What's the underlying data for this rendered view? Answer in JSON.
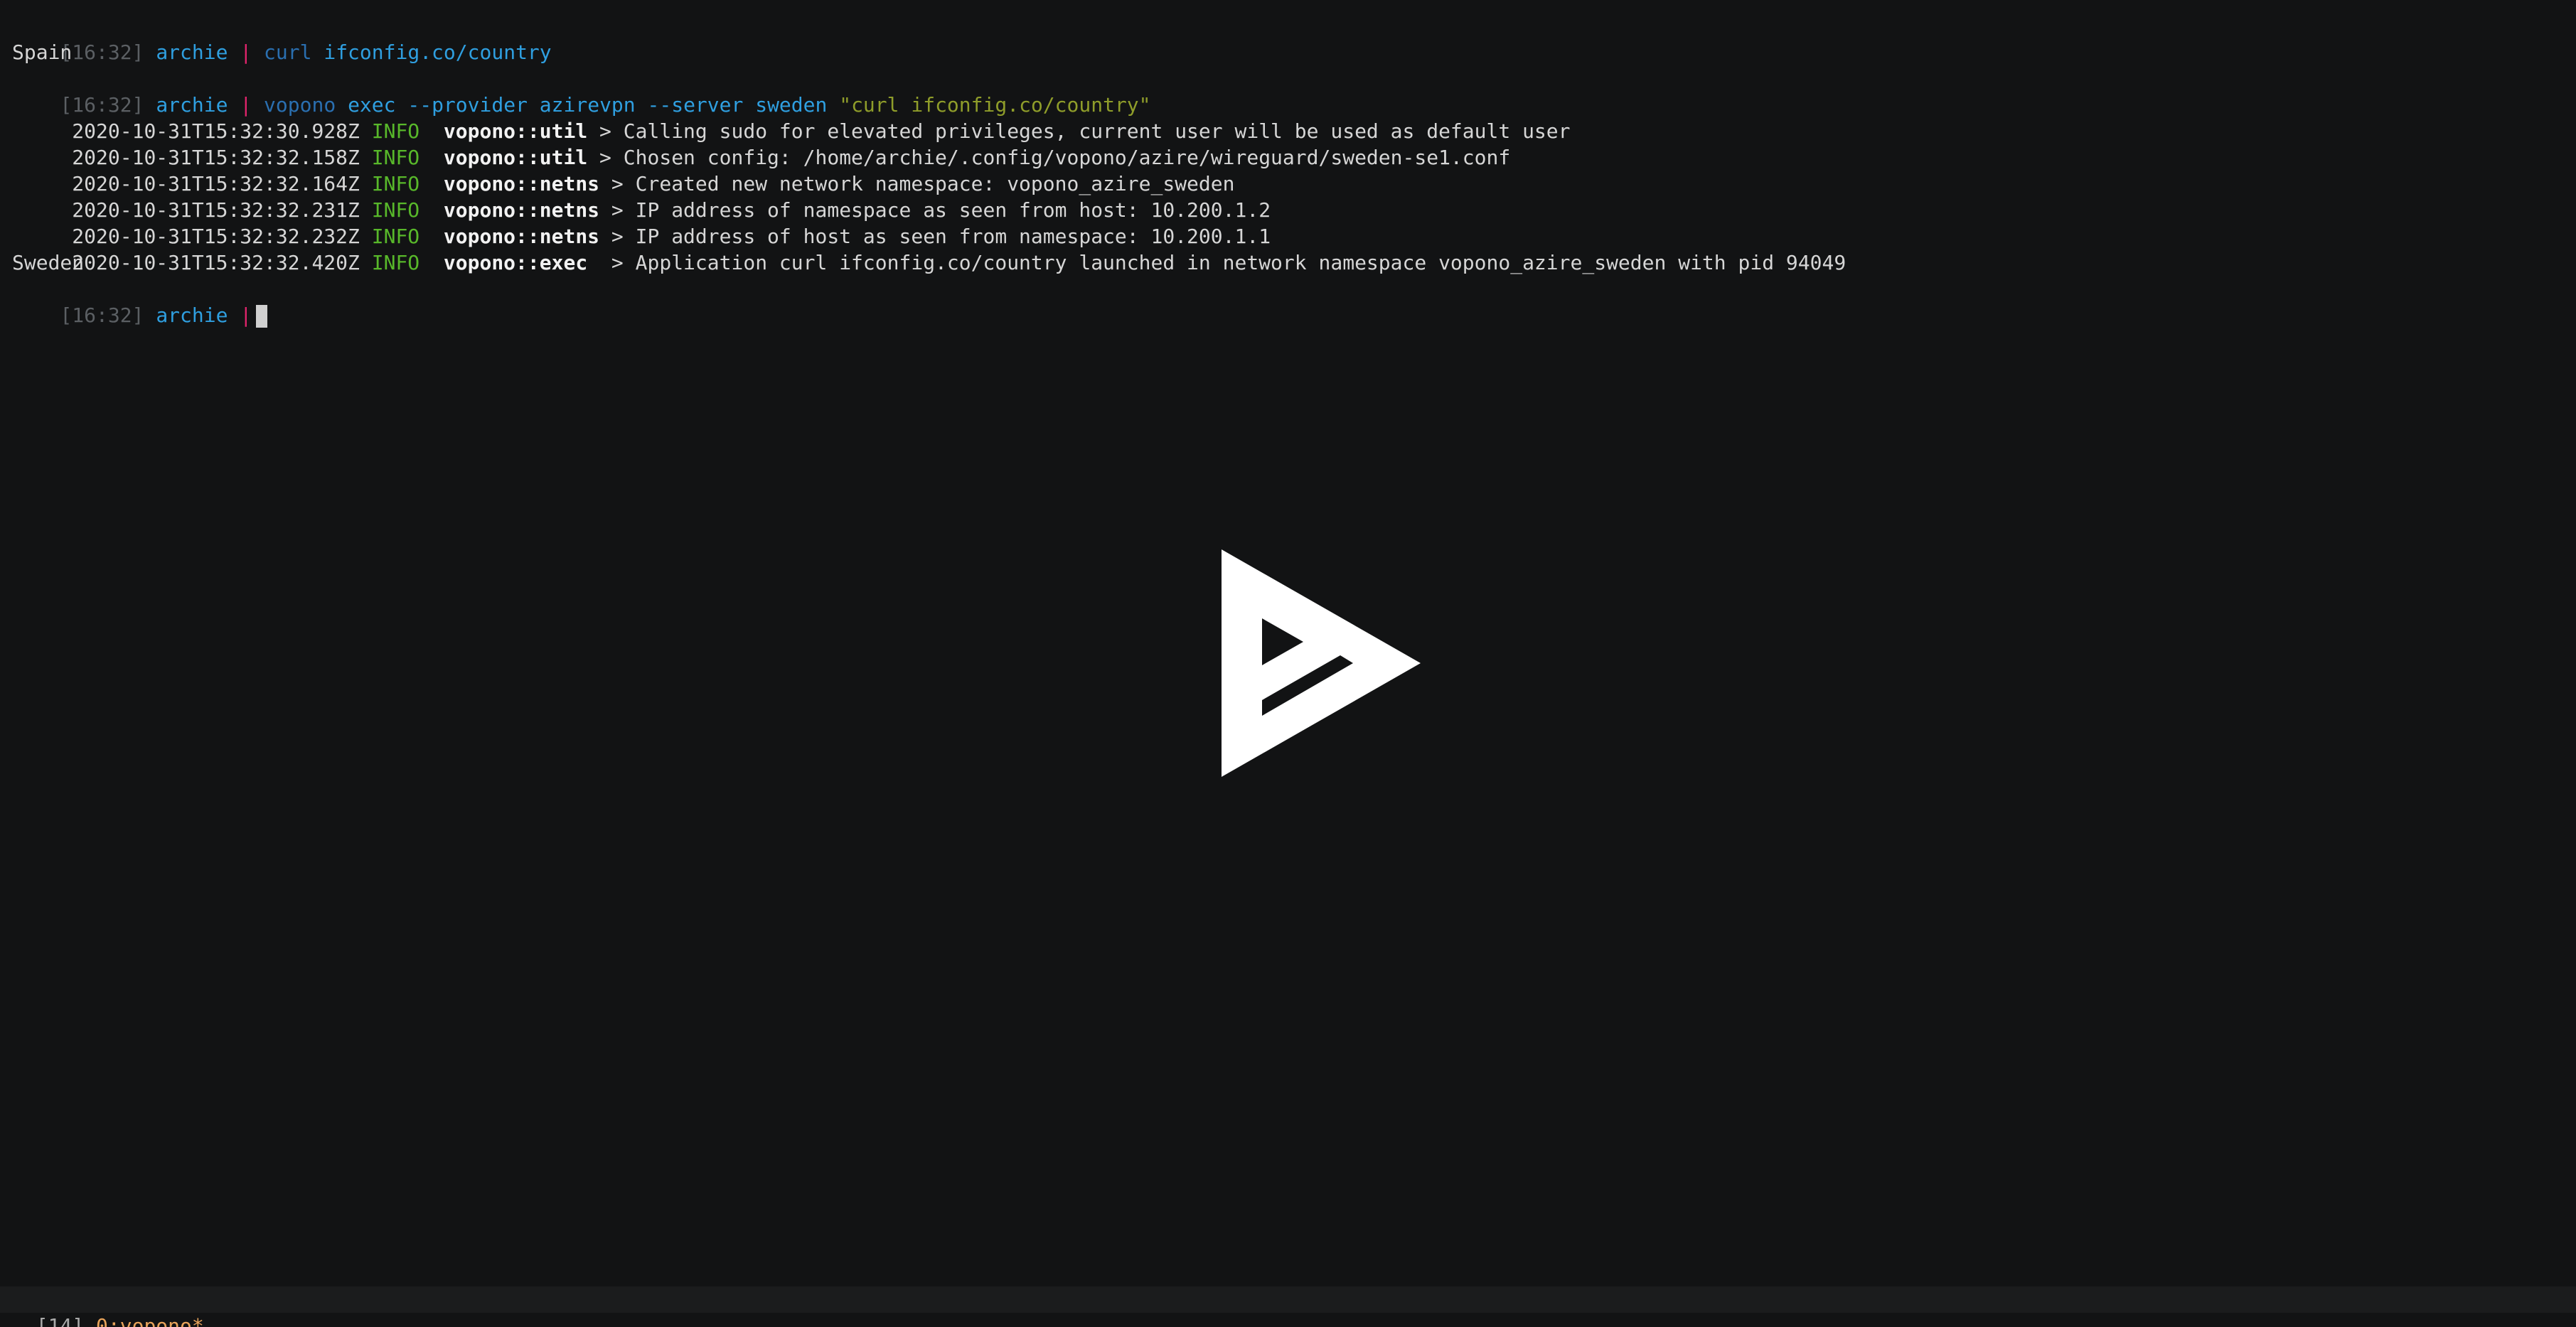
{
  "terminal": {
    "lines": [
      {
        "ts": "[16:32]",
        "user": "archie",
        "sep": "|",
        "cmd_dim": "curl",
        "cmd": "ifconfig.co/country"
      },
      {
        "text": "Spain"
      },
      {
        "ts": "[16:32]",
        "user": "archie",
        "sep": "|",
        "cmd_dim": "vopono",
        "cmd": "exec --provider azirevpn --server sweden",
        "str": "\"curl ifconfig.co/country\""
      },
      {
        "time": " 2020-10-31T15:32:30.928Z",
        "level": "INFO",
        "module": "vopono::util",
        "msg": " > Calling sudo for elevated privileges, current user will be used as default user"
      },
      {
        "time": " 2020-10-31T15:32:32.158Z",
        "level": "INFO",
        "module": "vopono::util",
        "msg": " > Chosen config: /home/archie/.config/vopono/azire/wireguard/sweden-se1.conf"
      },
      {
        "time": " 2020-10-31T15:32:32.164Z",
        "level": "INFO",
        "module": "vopono::netns",
        "msg": " > Created new network namespace: vopono_azire_sweden"
      },
      {
        "time": " 2020-10-31T15:32:32.231Z",
        "level": "INFO",
        "module": "vopono::netns",
        "msg": " > IP address of namespace as seen from host: 10.200.1.2"
      },
      {
        "time": " 2020-10-31T15:32:32.232Z",
        "level": "INFO",
        "module": "vopono::netns",
        "msg": " > IP address of host as seen from namespace: 10.200.1.1"
      },
      {
        "time": " 2020-10-31T15:32:32.420Z",
        "level": "INFO",
        "module": "vopono::exec",
        "msg": "  > Application curl ifconfig.co/country launched in network namespace vopono_azire_sweden with pid 94049"
      },
      {
        "text": "Sweden"
      },
      {
        "ts": "[16:32]",
        "user": "archie",
        "sep": "|"
      }
    ]
  },
  "player": {
    "icon": "asciinema-play-icon",
    "color": "#ffffff"
  },
  "statusbar": {
    "session": "[14]",
    "window": "0:vopono*"
  }
}
